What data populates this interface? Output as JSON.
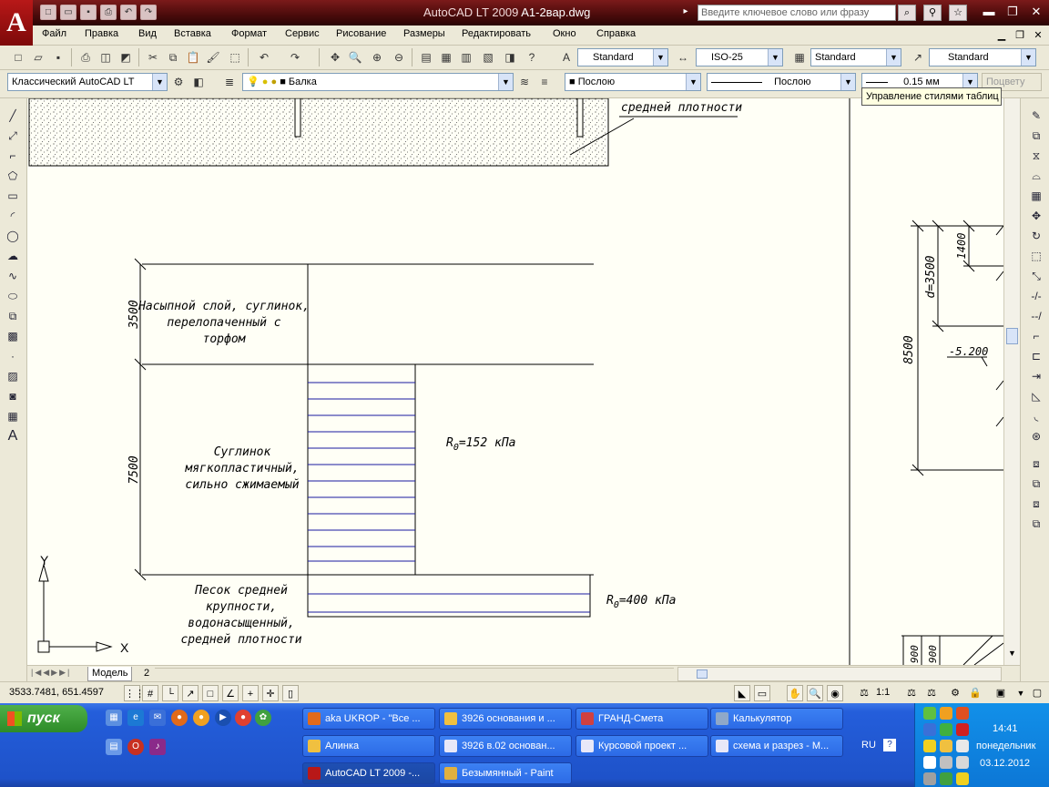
{
  "titlebar": {
    "app_name": "AutoCAD LT 2009",
    "file_name": "A1-2вар.dwg",
    "search_placeholder": "Введите ключевое слово или фразу"
  },
  "menu": [
    "Файл",
    "Правка",
    "Вид",
    "Вставка",
    "Формат",
    "Сервис",
    "Рисование",
    "Размеры",
    "Редактировать",
    "Окно",
    "Справка"
  ],
  "toolbar_std": {
    "text_style": "Standard",
    "dim_style": "ISO-25",
    "table_style": "Standard",
    "mleader_style": "Standard"
  },
  "toolbar_props": {
    "workspace": "Классический AutoCAD LT",
    "layer": "Балка",
    "color": "Послою",
    "linetype": "Послою",
    "lineweight": "0.15 мм",
    "plotstyle": "Поцвету"
  },
  "tooltip": "Управление стилями таблиц",
  "drawing": {
    "top_label": "средней плотности",
    "layer1": {
      "dim": "3500",
      "lines": [
        "Насыпной слой, суглинок,",
        "перелопаченный с",
        "торфом"
      ]
    },
    "layer2": {
      "dim": "7500",
      "lines": [
        "Суглинок",
        "мягкопластичный,",
        "сильно сжимаемый"
      ],
      "r_label": "R",
      "r_sub": "0",
      "r_value": "=152 кПа"
    },
    "layer3": {
      "lines": [
        "Песок средней",
        "крупности,",
        "водонасыщенный,",
        "средней плотности"
      ],
      "r_label": "R",
      "r_sub": "0",
      "r_value": "=400 кПа"
    },
    "right_dims": {
      "d1": "8500",
      "d2": "d=3500",
      "d3": "1400",
      "level": "-5.200",
      "b1": "900",
      "b2": "900"
    },
    "ucs_x": "X",
    "ucs_y": "Y"
  },
  "tabs": [
    "Модель",
    "2"
  ],
  "status": {
    "coords": "3533.7481, 651.4597",
    "scale": "1:1"
  },
  "taskbar": {
    "start": "пуск",
    "tasks": [
      "aka UKROP - \"Все ...",
      "3926 основания и ...",
      "ГРАНД-Смета",
      "Калькулятор",
      "Алинка",
      "3926 в.02 основан...",
      "Курсовой проект ...",
      "схема и разрез - M...",
      "AutoCAD LT 2009 -...",
      "Безымянный - Paint"
    ],
    "lang": "RU",
    "time": "14:41",
    "day": "понедельник",
    "date": "03.12.2012"
  },
  "colors": {
    "title_bg": "#5a1010",
    "canvas_bg": "#fffff6",
    "hatch_line": "#1a1aa0",
    "taskbar": "#245edb"
  }
}
